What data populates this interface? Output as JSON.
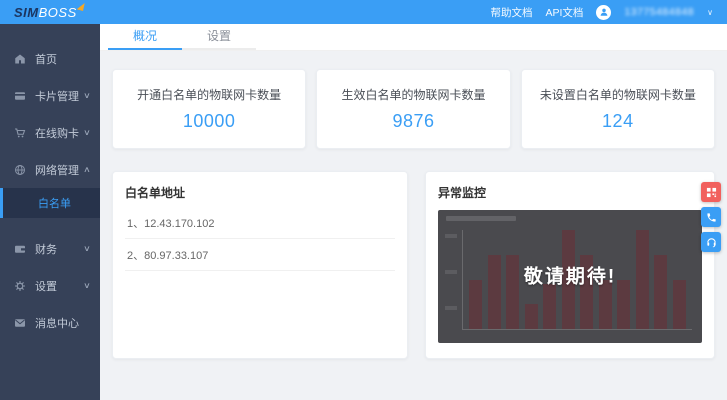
{
  "colors": {
    "header_bg": "#3a9ef5",
    "accent_blue": "#3a9ef5",
    "sidebar_bg": "#364158",
    "sidebar_active_bg": "#27334b",
    "chart_bg": "#4a4a4e",
    "chart_bar": "#5c3a40",
    "btn_red": "#f1605d",
    "btn_blue": "#3a9ef5"
  },
  "glyphs": {
    "chevron_down": "∨",
    "chevron_up": "∧",
    "user_caret": "∨"
  },
  "header": {
    "logo_sim": "SIM",
    "logo_boss": "BOSS",
    "help_link": "帮助文档",
    "api_link": "API文档",
    "user_phone": "13775484848"
  },
  "sidebar": {
    "items": [
      {
        "label": "首页"
      },
      {
        "label": "卡片管理"
      },
      {
        "label": "在线购卡"
      },
      {
        "label": "网络管理"
      },
      {
        "label": "白名单"
      },
      {
        "label": "财务"
      },
      {
        "label": "设置"
      },
      {
        "label": "消息中心"
      }
    ]
  },
  "tabs": {
    "overview": "概况",
    "settings": "设置"
  },
  "stats": [
    {
      "label": "开通白名单的物联网卡数量",
      "value": "10000"
    },
    {
      "label": "生效白名单的物联网卡数量",
      "value": "9876"
    },
    {
      "label": "未设置白名单的物联网卡数量",
      "value": "124"
    }
  ],
  "whitelist": {
    "title": "白名单地址",
    "items": [
      "1、12.43.170.102",
      "2、80.97.33.107"
    ]
  },
  "monitor": {
    "title": "异常监控",
    "overlay_text": "敬请期待!"
  },
  "chart_data": {
    "type": "bar",
    "title": "异常监控 (dimmed placeholder chart behind overlay)",
    "values": [
      50,
      75,
      75,
      25,
      45,
      100,
      75,
      50,
      50,
      100,
      75,
      50
    ],
    "ylim": [
      0,
      100
    ],
    "bar_color": "#5c3a40",
    "background": "#4a4a4e"
  },
  "float_buttons": [
    {
      "icon": "qrcode-icon",
      "color": "#f1605d"
    },
    {
      "icon": "phone-icon",
      "color": "#3a9ef5"
    },
    {
      "icon": "headset-icon",
      "color": "#3a9ef5"
    }
  ]
}
